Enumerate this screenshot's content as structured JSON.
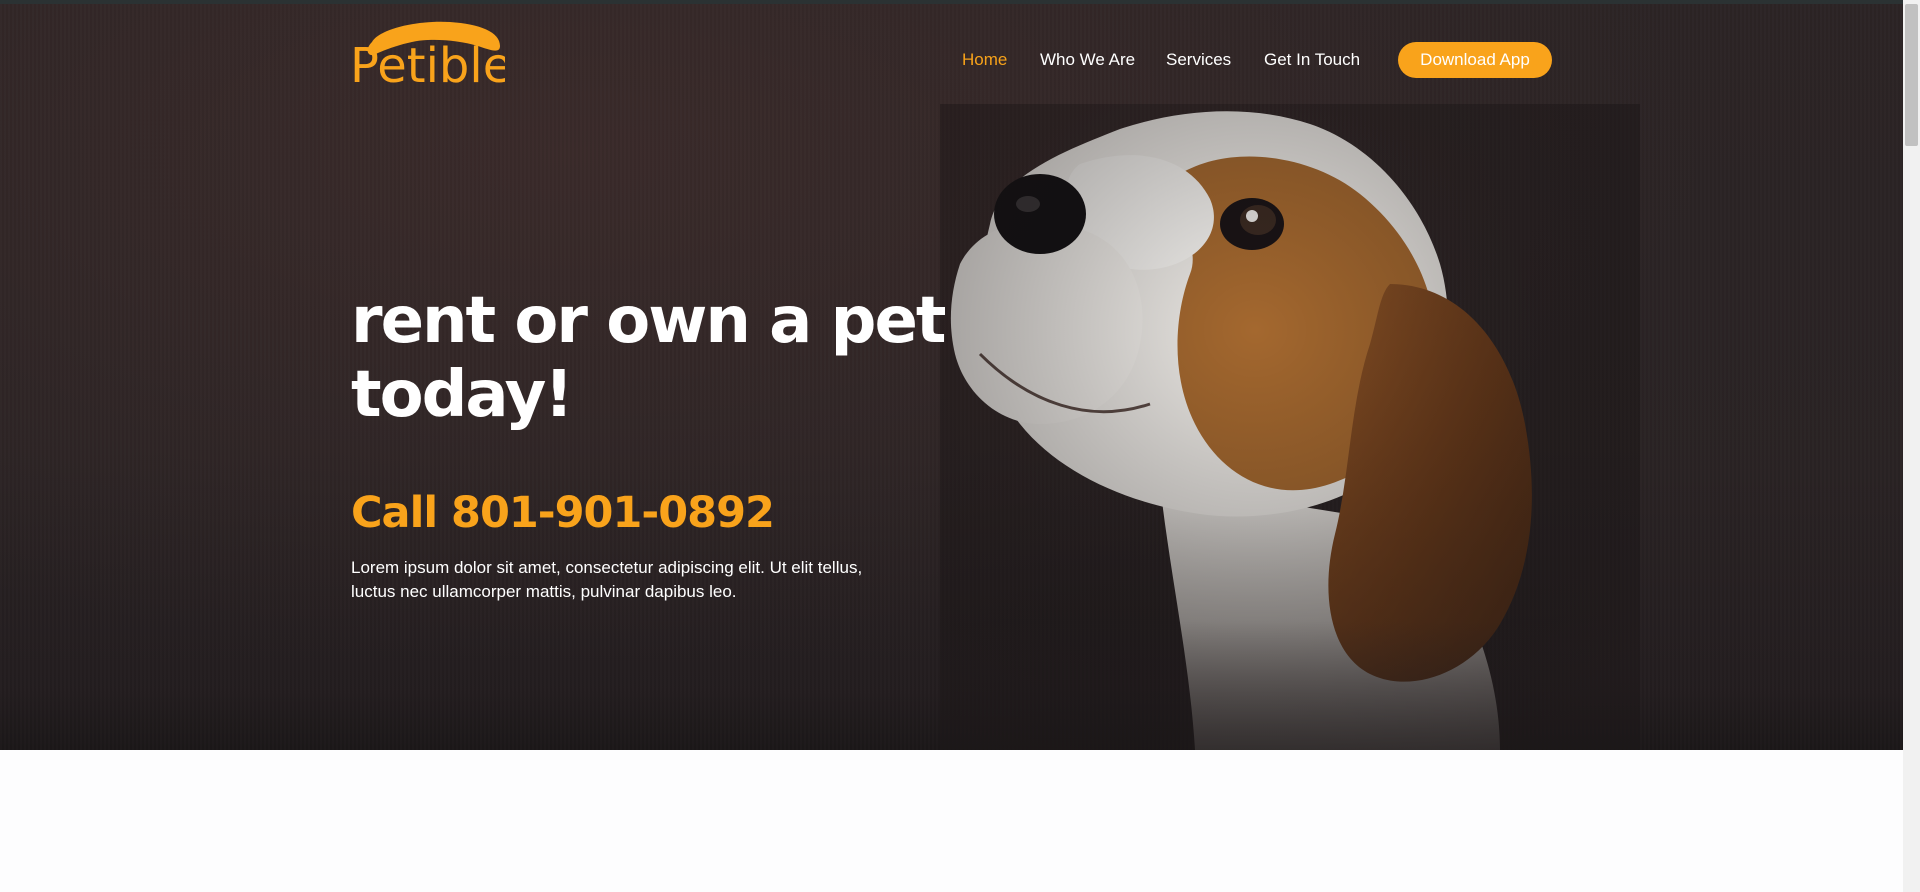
{
  "brand": {
    "logo_text": "Petible"
  },
  "nav": {
    "items": [
      {
        "label": "Home",
        "active": true
      },
      {
        "label": "Who We Are",
        "active": false
      },
      {
        "label": "Services",
        "active": false
      },
      {
        "label": "Get In Touch",
        "active": false
      }
    ],
    "cta_label": "Download App"
  },
  "hero": {
    "headline_line1": "rent or own a pet",
    "headline_line2": "today!",
    "phone": "Call 801-901-0892",
    "lead_line1": "Lorem ipsum dolor sit amet, consectetur adipiscing elit. Ut elit tellus,",
    "lead_line2": "luctus nec ullamcorper mattis, pulvinar dapibus leo."
  },
  "colors": {
    "accent": "#f9a31b",
    "hero_background": "#2a2324",
    "text_on_dark": "#ffffff",
    "page_background": "#fdfdfe"
  },
  "icons": {
    "hero_image": "beagle-puppy-photo"
  }
}
